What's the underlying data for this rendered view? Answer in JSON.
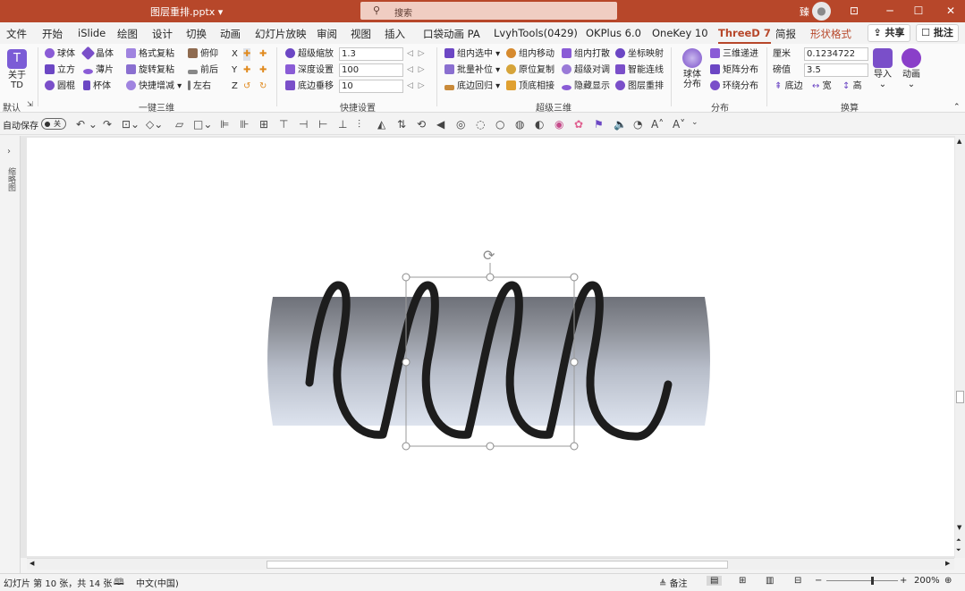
{
  "title_bar": {
    "file_name": "图层重排.pptx",
    "search_placeholder": "搜索",
    "user_char": "臻",
    "win_min": "─",
    "win_max": "☐",
    "win_close": "✕",
    "win_ribbon": "⊡"
  },
  "tabs": [
    "文件",
    "开始",
    "iSlide",
    "绘图",
    "设计",
    "切换",
    "动画",
    "幻灯片放映",
    "审阅",
    "视图",
    "插入",
    "口袋动画 PA",
    "LvyhTools(0429)",
    "OKPlus 6.0",
    "OneKey 10",
    "ThreeD 7",
    "简报",
    "形状格式"
  ],
  "actions": {
    "share": "共享",
    "comment": "批注"
  },
  "ribbon": {
    "about": {
      "label1": "关于",
      "label2": "TD"
    },
    "default_label": "默认",
    "group1": {
      "name": "一键三维",
      "items": [
        "球体",
        "晶体",
        "格式复粘",
        "俯仰",
        "立方",
        "薄片",
        "旋转复粘",
        "前后",
        "圆棍",
        "杯体",
        "快捷增减",
        "左右"
      ]
    },
    "axes": [
      "X",
      "Y",
      "Z"
    ],
    "group2": {
      "name": "快捷设置",
      "rows": [
        {
          "label": "超级缩放",
          "value": "1.3"
        },
        {
          "label": "深度设置",
          "value": "100"
        },
        {
          "label": "底边垂移",
          "value": "10"
        }
      ]
    },
    "group3": {
      "name": "超级三维",
      "items": [
        "组内选中",
        "组内移动",
        "组内打散",
        "坐标映射",
        "批量补位",
        "原位复制",
        "超级对调",
        "智能连线",
        "底边回归",
        "顶底相接",
        "隐藏显示",
        "图层重排"
      ]
    },
    "group4": {
      "name": "分布",
      "sphere_label1": "球体",
      "sphere_label2": "分布",
      "items": [
        "三维递进",
        "矩阵分布",
        "环绕分布"
      ]
    },
    "group5": {
      "name": "换算",
      "rows": [
        {
          "label": "厘米",
          "value": "0.1234722"
        },
        {
          "label": "磅值",
          "value": "3.5"
        }
      ],
      "dims": [
        "底边",
        "宽",
        "高"
      ],
      "import_label": "导入",
      "anim_label": "动画"
    }
  },
  "qat": {
    "autosave": "自动保存",
    "toggle_state": "关"
  },
  "left_pane": {
    "label": "缩略图"
  },
  "status": {
    "slide_info": "幻灯片 第 10 张，共 14 张",
    "language": "中文(中国)",
    "notes": "备注",
    "zoom": "200%"
  },
  "colors": {
    "accent": "#b7472a",
    "cylinder_top": "#6e7179",
    "cylinder_bottom": "#dde3ee",
    "spring": "#262626"
  }
}
